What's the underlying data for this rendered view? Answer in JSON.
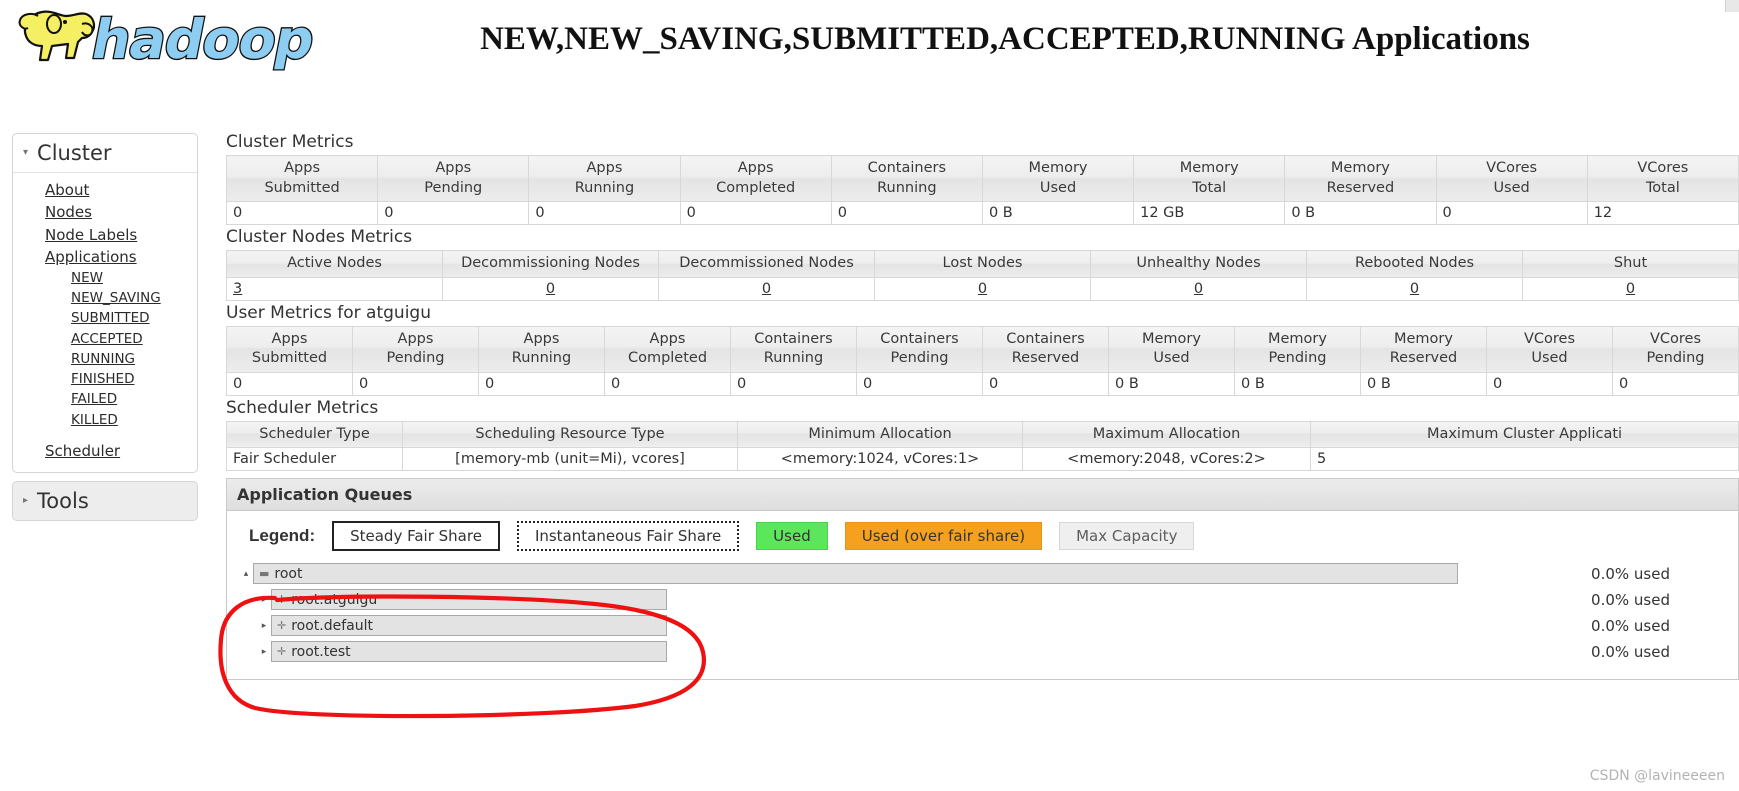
{
  "header": {
    "logo_alt": "hadoop",
    "title": "NEW,NEW_SAVING,SUBMITTED,ACCEPTED,RUNNING Applications"
  },
  "sidebar": {
    "cluster": {
      "heading": "Cluster",
      "expanded_icon": "▾",
      "links": [
        {
          "label": "About"
        },
        {
          "label": "Nodes"
        },
        {
          "label": "Node Labels"
        },
        {
          "label": "Applications"
        }
      ],
      "app_states": [
        {
          "label": "NEW"
        },
        {
          "label": "NEW_SAVING"
        },
        {
          "label": "SUBMITTED"
        },
        {
          "label": "ACCEPTED"
        },
        {
          "label": "RUNNING"
        },
        {
          "label": "FINISHED"
        },
        {
          "label": "FAILED"
        },
        {
          "label": "KILLED"
        }
      ],
      "scheduler": {
        "label": "Scheduler"
      }
    },
    "tools": {
      "heading": "Tools",
      "collapsed_icon": "▸"
    }
  },
  "cluster_metrics": {
    "title": "Cluster Metrics",
    "headers": [
      "Apps\nSubmitted",
      "Apps\nPending",
      "Apps\nRunning",
      "Apps\nCompleted",
      "Containers\nRunning",
      "Memory\nUsed",
      "Memory\nTotal",
      "Memory\nReserved",
      "VCores\nUsed",
      "VCores\nTotal"
    ],
    "values": [
      "0",
      "0",
      "0",
      "0",
      "0",
      "0 B",
      "12 GB",
      "0 B",
      "0",
      "12"
    ]
  },
  "cluster_nodes_metrics": {
    "title": "Cluster Nodes Metrics",
    "headers": [
      "Active Nodes",
      "Decommissioning Nodes",
      "Decommissioned Nodes",
      "Lost Nodes",
      "Unhealthy Nodes",
      "Rebooted Nodes",
      "Shut"
    ],
    "values": [
      "3",
      "0",
      "0",
      "0",
      "0",
      "0",
      "0"
    ]
  },
  "user_metrics": {
    "title": "User Metrics for atguigu",
    "headers": [
      "Apps\nSubmitted",
      "Apps\nPending",
      "Apps\nRunning",
      "Apps\nCompleted",
      "Containers\nRunning",
      "Containers\nPending",
      "Containers\nReserved",
      "Memory\nUsed",
      "Memory\nPending",
      "Memory\nReserved",
      "VCores\nUsed",
      "VCores\nPending"
    ],
    "values": [
      "0",
      "0",
      "0",
      "0",
      "0",
      "0",
      "0",
      "0 B",
      "0 B",
      "0 B",
      "0",
      "0"
    ]
  },
  "scheduler_metrics": {
    "title": "Scheduler Metrics",
    "headers": [
      "Scheduler Type",
      "Scheduling Resource Type",
      "Minimum Allocation",
      "Maximum Allocation",
      "Maximum Cluster Applicati"
    ],
    "values": [
      "Fair Scheduler",
      "[memory-mb (unit=Mi), vcores]",
      "<memory:1024, vCores:1>",
      "<memory:2048, vCores:2>",
      "5"
    ]
  },
  "application_queues": {
    "title": "Application Queues",
    "legend": {
      "label": "Legend:",
      "items": [
        {
          "label": "Steady Fair Share",
          "style": "steady"
        },
        {
          "label": "Instantaneous Fair Share",
          "style": "inst"
        },
        {
          "label": "Used",
          "style": "used"
        },
        {
          "label": "Used (over fair share)",
          "style": "over"
        },
        {
          "label": "Max Capacity",
          "style": "maxcap"
        }
      ]
    },
    "queues": [
      {
        "name": "root",
        "used": "0.0% used",
        "arrow": "▴",
        "icon": "▬",
        "depth": 0
      },
      {
        "name": "root.atguigu",
        "used": "0.0% used",
        "arrow": "▸",
        "icon": "✛",
        "depth": 1
      },
      {
        "name": "root.default",
        "used": "0.0% used",
        "arrow": "▸",
        "icon": "✛",
        "depth": 1
      },
      {
        "name": "root.test",
        "used": "0.0% used",
        "arrow": "▸",
        "icon": "✛",
        "depth": 1
      }
    ]
  },
  "watermark": {
    "text": "CSDN @lavineeeen"
  },
  "colors": {
    "used_green": "#5ce65c",
    "over_orange": "#f5a11e",
    "annotation_red": "#ee1111",
    "logo_blue": "#8ecdf2",
    "logo_yellow": "#f2ec5a"
  }
}
